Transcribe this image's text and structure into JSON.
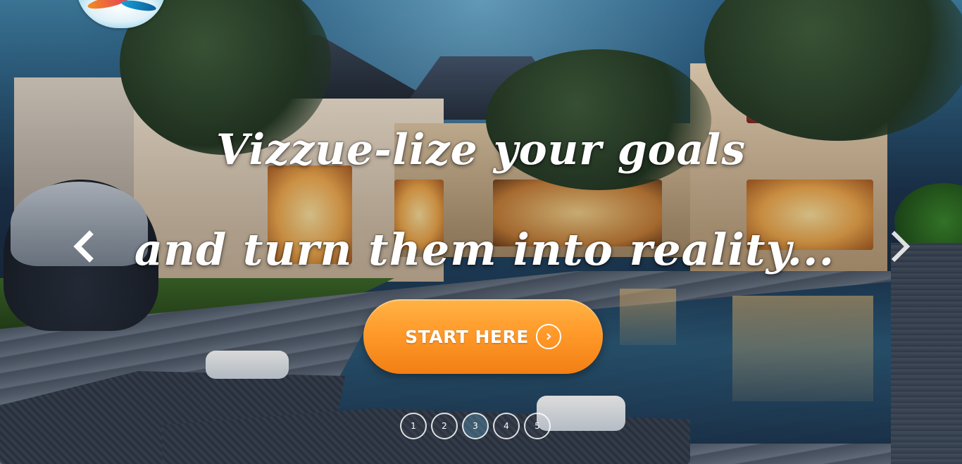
{
  "hero": {
    "headline_line1": "Vizzue-lize your goals",
    "headline_line2": "and turn them into reality...",
    "cta_label": "START HERE",
    "cta_icon": "chevron-right-circle-icon",
    "prev_icon": "chevron-left-icon",
    "next_icon": "chevron-right-icon"
  },
  "logo": {
    "icon": "brand-logo"
  },
  "pager": {
    "active_index": 2,
    "items": [
      "1",
      "2",
      "3",
      "4",
      "5"
    ]
  },
  "colors": {
    "cta_top": "#ffb347",
    "cta_bottom": "#f27f14",
    "text": "#ffffff"
  }
}
